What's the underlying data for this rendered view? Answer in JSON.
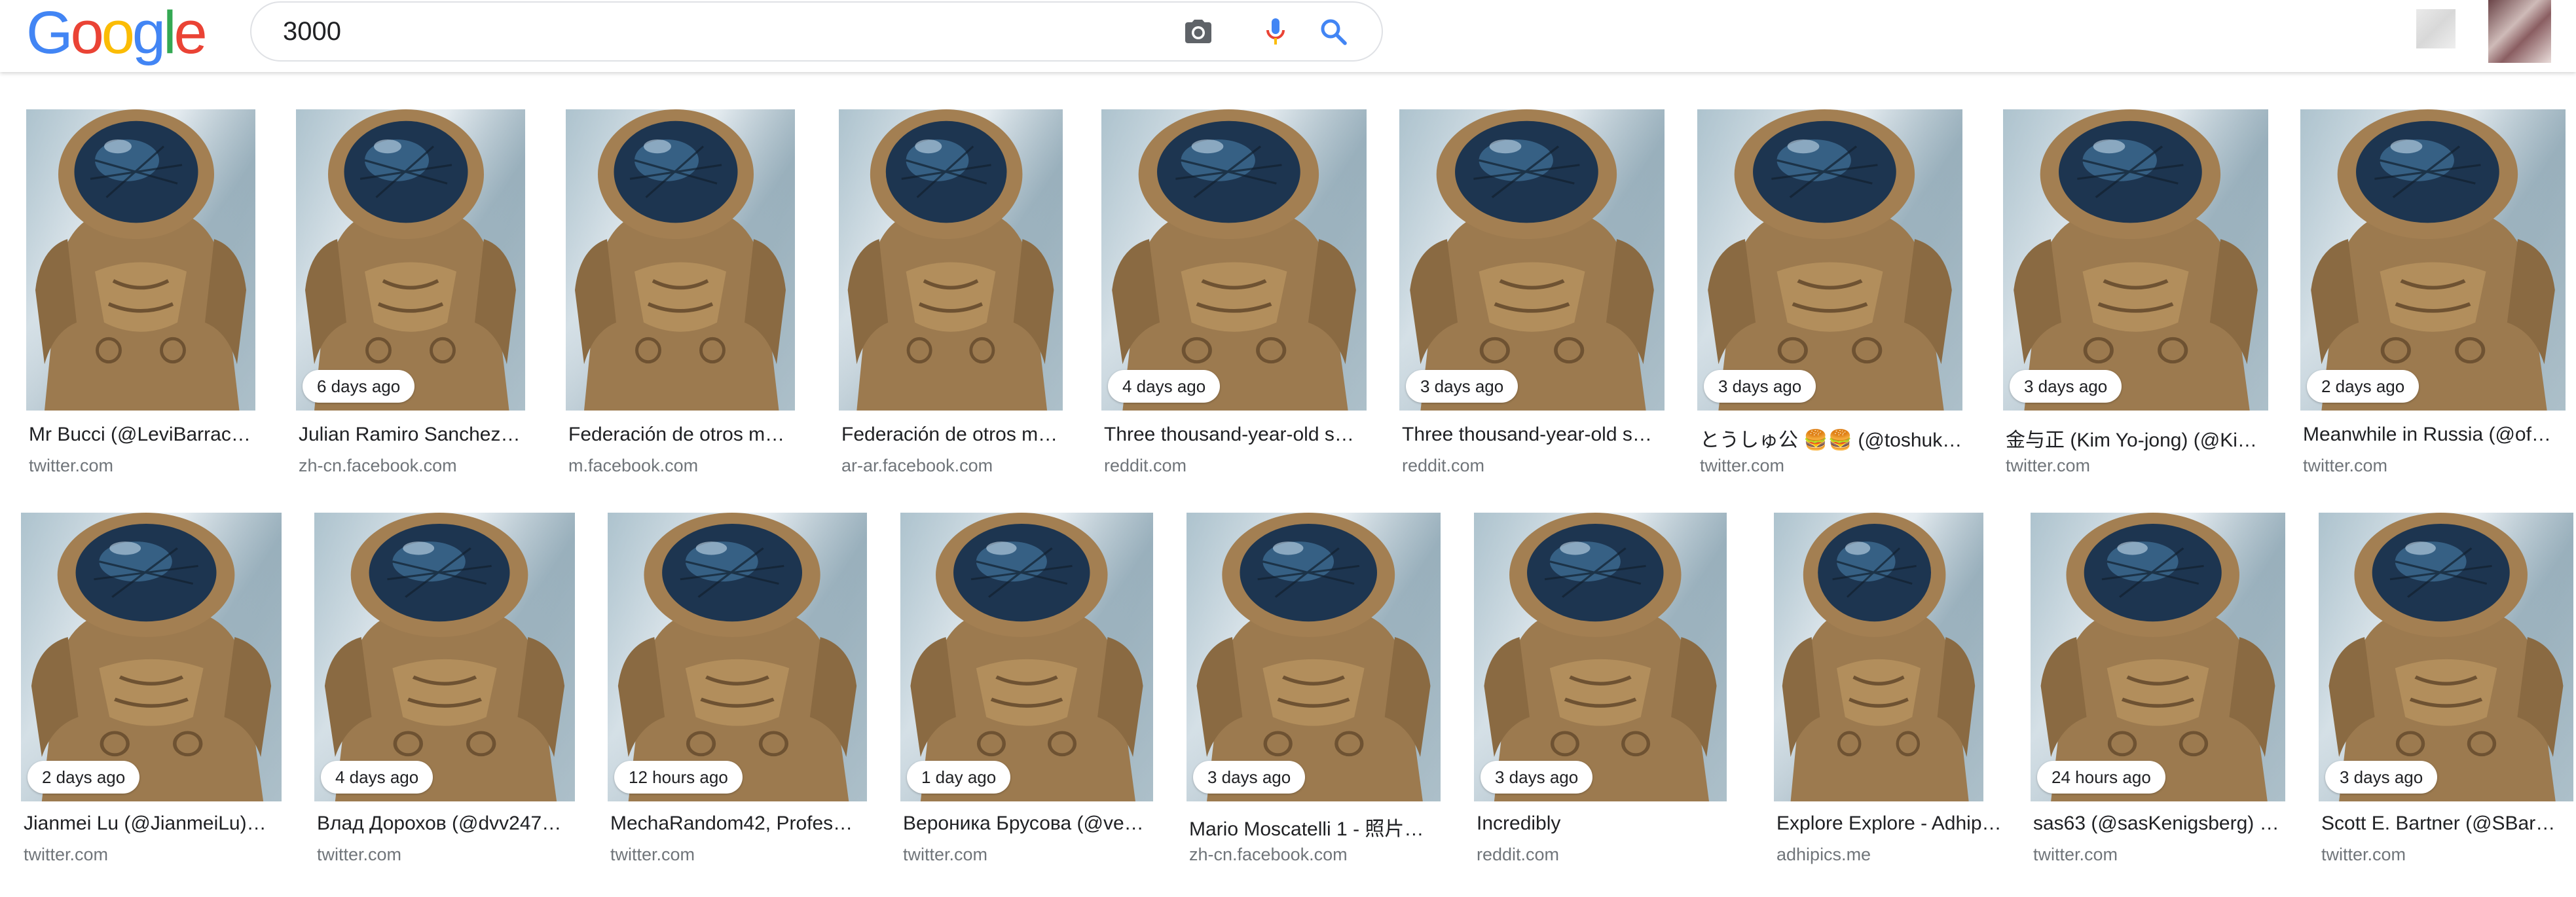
{
  "search": {
    "query": "3000"
  },
  "logo": {
    "letters": [
      "G",
      "o",
      "o",
      "g",
      "l",
      "e"
    ],
    "colors": [
      "#4285F4",
      "#EA4335",
      "#FBBC05",
      "#4285F4",
      "#34A853",
      "#EA4335"
    ]
  },
  "icons": {
    "camera": "camera-icon",
    "mic": "microphone-icon",
    "search": "search-icon"
  },
  "colors": {
    "mic_blue": "#4285F4",
    "mic_red": "#EA4335",
    "search_blue": "#4285F4"
  },
  "results": [
    {
      "title": "Mr Bucci (@LeviBarrac…",
      "source": "twitter.com",
      "badge": ""
    },
    {
      "title": "Julian Ramiro Sanchez…",
      "source": "zh-cn.facebook.com",
      "badge": "6 days ago"
    },
    {
      "title": "Federación de otros m…",
      "source": "m.facebook.com",
      "badge": ""
    },
    {
      "title": "Federación de otros m…",
      "source": "ar-ar.facebook.com",
      "badge": ""
    },
    {
      "title": "Three thousand-year-old s…",
      "source": "reddit.com",
      "badge": "4 days ago"
    },
    {
      "title": "Three thousand-year-old s…",
      "source": "reddit.com",
      "badge": "3 days ago"
    },
    {
      "title": "とうしゅ公 🍔🍔 (@toshuk…",
      "source": "twitter.com",
      "badge": "3 days ago"
    },
    {
      "title": "金与正 (Kim Yo-jong) (@Ki…",
      "source": "twitter.com",
      "badge": "3 days ago"
    },
    {
      "title": "Meanwhile in Russia (@of…",
      "source": "twitter.com",
      "badge": "2 days ago"
    },
    {
      "title": "Jianmei Lu (@JianmeiLu)…",
      "source": "twitter.com",
      "badge": "2 days ago"
    },
    {
      "title": "Влад Дорохов (@dvv247…",
      "source": "twitter.com",
      "badge": "4 days ago"
    },
    {
      "title": "MechaRandom42, Profes…",
      "source": "twitter.com",
      "badge": "12 hours ago"
    },
    {
      "title": "Вероника Брусова (@ve…",
      "source": "twitter.com",
      "badge": "1 day ago"
    },
    {
      "title": "Mario Moscatelli 1 - 照片…",
      "source": "zh-cn.facebook.com",
      "badge": "3 days ago"
    },
    {
      "title": "Incredibly",
      "source": "reddit.com",
      "badge": "3 days ago"
    },
    {
      "title": "Explore Explore - Adhip…",
      "source": "adhipics.me",
      "badge": ""
    },
    {
      "title": "sas63 (@sasKenigsberg) …",
      "source": "twitter.com",
      "badge": "24 hours ago"
    },
    {
      "title": "Scott E. Bartner (@SBar…",
      "source": "twitter.com",
      "badge": "3 days ago"
    }
  ]
}
